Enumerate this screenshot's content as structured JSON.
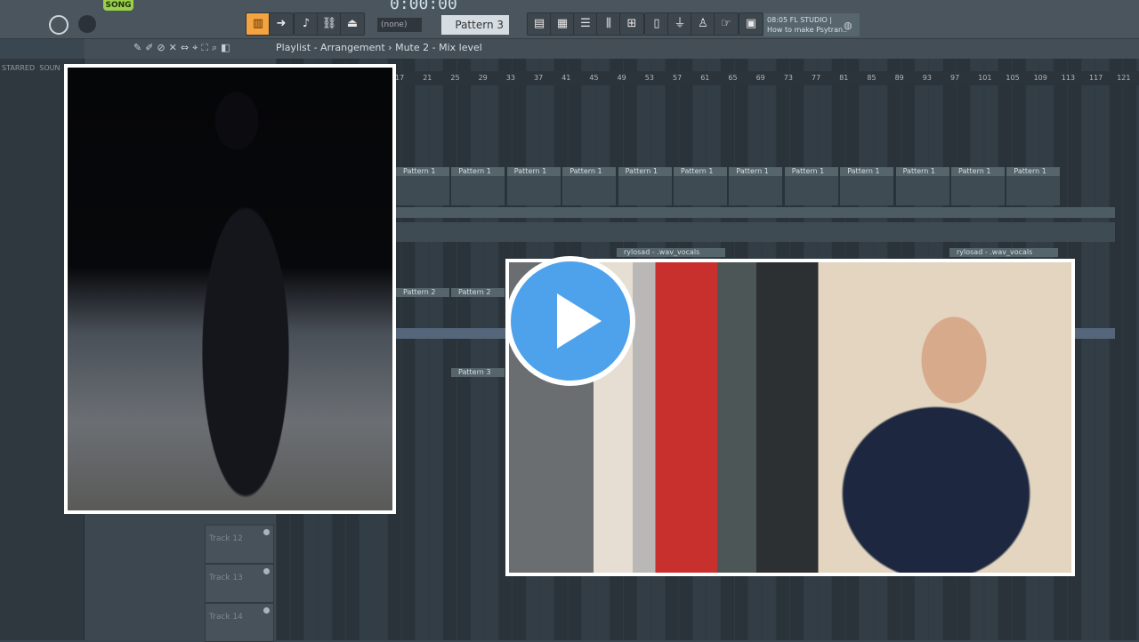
{
  "toolbar": {
    "song_label": "SONG",
    "time": "0:00:00",
    "snap": "(none)",
    "pattern": "Pattern 3",
    "hint_time": "08:05",
    "hint_title": "FL STUDIO |",
    "hint_text": "How to make Psytran..",
    "accent": "#f3a340"
  },
  "breadcrumb": {
    "path": "Playlist - Arrangement",
    "sep": "›",
    "sub": "Mute 2 - Mix level"
  },
  "browser": {
    "tabs": [
      "STARRED",
      "SOUN"
    ]
  },
  "ruler": [
    17,
    21,
    25,
    29,
    33,
    37,
    41,
    45,
    49,
    53,
    57,
    61,
    65,
    69,
    73,
    77,
    81,
    85,
    89,
    93,
    97,
    101,
    105,
    109,
    113,
    117,
    121
  ],
  "tracks": [
    "Track 12",
    "Track 13",
    "Track 14"
  ],
  "clips": {
    "pattern1": "Pattern 1",
    "pattern2": "Pattern 2",
    "pattern3": "Pattern 3",
    "vocals": "rylosad - .wav_vocals"
  },
  "overlay": {
    "play_color": "#4ea2ec"
  }
}
